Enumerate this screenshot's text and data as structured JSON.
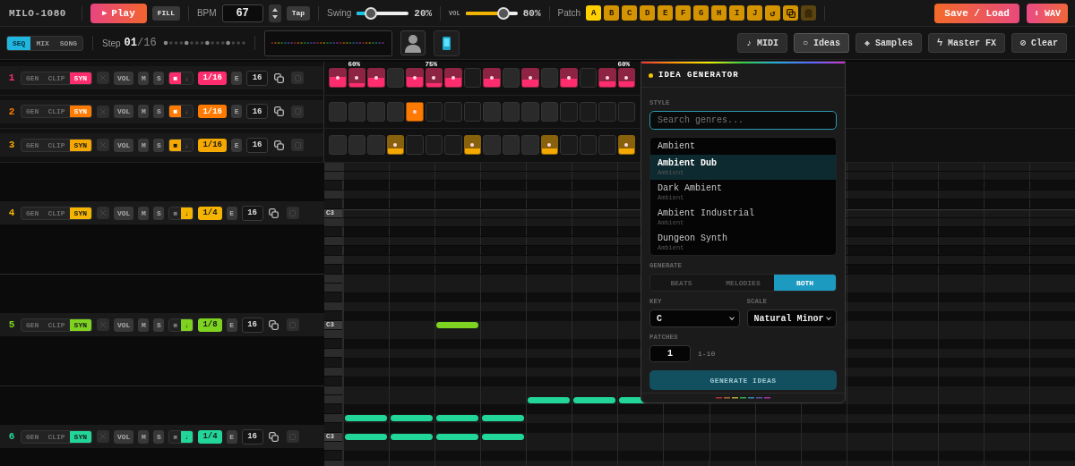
{
  "app": {
    "title": "MILO-1080"
  },
  "transport": {
    "play": {
      "icon": "▶",
      "label": "Play"
    },
    "fill": "FILL",
    "bpm_label": "BPM",
    "bpm": "67",
    "tap": "Tap",
    "swing": {
      "label": "Swing",
      "level": 0.2,
      "reading": "20%"
    },
    "volume": {
      "label": "VOL",
      "level": 0.8,
      "reading": "80%"
    }
  },
  "patches": {
    "label": "Patch",
    "items": [
      {
        "label": "A",
        "selected": true
      },
      {
        "label": "B",
        "selected": false
      },
      {
        "label": "C",
        "selected": false
      },
      {
        "label": "D",
        "selected": false
      },
      {
        "label": "E",
        "selected": false
      },
      {
        "label": "F",
        "selected": false
      },
      {
        "label": "G",
        "selected": false
      },
      {
        "label": "H",
        "selected": false
      },
      {
        "label": "I",
        "selected": false
      },
      {
        "label": "J",
        "selected": false
      }
    ],
    "tools": [
      {
        "kind": "undo",
        "glyph": "↺",
        "disabled": false
      },
      {
        "kind": "copy",
        "disabled": false
      },
      {
        "kind": "paste",
        "disabled": true
      }
    ]
  },
  "file": {
    "save": "Save / Load",
    "export": "⬇ WAV"
  },
  "views": [
    {
      "label": "SEQ",
      "selected": true
    },
    {
      "label": "MIX",
      "selected": false
    },
    {
      "label": "SONG",
      "selected": false
    }
  ],
  "step": {
    "label": "Step",
    "current": "01",
    "total": "/16"
  },
  "tools": [
    {
      "label": "♪ MIDI",
      "selected": false
    },
    {
      "label": "○ Ideas",
      "selected": true
    },
    {
      "label": "◈ Samples",
      "selected": false
    },
    {
      "label": "ϟ Master FX",
      "selected": false
    },
    {
      "label": "⊘ Clear",
      "selected": false
    }
  ],
  "tracks": [
    {
      "number": "1",
      "color": "#ff2d6e",
      "kind": "steps",
      "sources": [
        {
          "label": "GEN",
          "selected": false
        },
        {
          "label": "CLIP",
          "selected": false
        },
        {
          "label": "SYN",
          "selected": true
        }
      ],
      "vol": "VOL",
      "mute": "M",
      "solo": "S",
      "modes": [
        {
          "label": "■",
          "selected": true
        },
        {
          "label": "♩",
          "selected": false
        }
      ],
      "division": "1/16",
      "edit": "E",
      "length": "16",
      "steps": [
        {
          "on": true,
          "level": 0.55
        },
        {
          "on": true,
          "level": 0.2,
          "label": "60%"
        },
        {
          "on": true,
          "level": 0.5
        },
        {
          "on": false
        },
        {
          "on": true,
          "level": 0.55
        },
        {
          "on": true,
          "level": 0.2,
          "label": "75%"
        },
        {
          "on": true,
          "level": 0.5
        },
        {
          "on": false
        },
        {
          "on": true,
          "level": 0.45
        },
        {
          "on": false
        },
        {
          "on": true,
          "level": 0.4
        },
        {
          "on": false
        },
        {
          "on": true,
          "level": 0.45
        },
        {
          "on": false
        },
        {
          "on": true,
          "level": 0.3
        },
        {
          "on": true,
          "level": 0.3,
          "label": "60%"
        }
      ]
    },
    {
      "number": "2",
      "color": "#ff7a00",
      "kind": "steps",
      "sources": [
        {
          "label": "GEN",
          "selected": false
        },
        {
          "label": "CLIP",
          "selected": false
        },
        {
          "label": "SYN",
          "selected": true
        }
      ],
      "vol": "VOL",
      "mute": "M",
      "solo": "S",
      "modes": [
        {
          "label": "■",
          "selected": true
        },
        {
          "label": "♩",
          "selected": false
        }
      ],
      "division": "1/16",
      "edit": "E",
      "length": "16",
      "steps": [
        {
          "on": false
        },
        {
          "on": false
        },
        {
          "on": false
        },
        {
          "on": false
        },
        {
          "on": true,
          "level": 1
        },
        {
          "on": false
        },
        {
          "on": false
        },
        {
          "on": false
        },
        {
          "on": false
        },
        {
          "on": false
        },
        {
          "on": false
        },
        {
          "on": false
        },
        {
          "on": false
        },
        {
          "on": false
        },
        {
          "on": false
        },
        {
          "on": false
        }
      ]
    },
    {
      "number": "3",
      "color": "#f5a800",
      "kind": "steps",
      "sources": [
        {
          "label": "GEN",
          "selected": false
        },
        {
          "label": "CLIP",
          "selected": false
        },
        {
          "label": "SYN",
          "selected": true
        }
      ],
      "vol": "VOL",
      "mute": "M",
      "solo": "S",
      "modes": [
        {
          "label": "■",
          "selected": true
        },
        {
          "label": "♩",
          "selected": false
        }
      ],
      "division": "1/16",
      "edit": "E",
      "length": "16",
      "steps": [
        {
          "on": false
        },
        {
          "on": false
        },
        {
          "on": false
        },
        {
          "on": true,
          "level": 0.3
        },
        {
          "on": false
        },
        {
          "on": false
        },
        {
          "on": false
        },
        {
          "on": true,
          "level": 0.3
        },
        {
          "on": false
        },
        {
          "on": false
        },
        {
          "on": false
        },
        {
          "on": true,
          "level": 0.3
        },
        {
          "on": false
        },
        {
          "on": false
        },
        {
          "on": false
        },
        {
          "on": true,
          "level": 0.3
        }
      ]
    },
    {
      "number": "4",
      "color": "#f5b400",
      "kind": "roll",
      "sources": [
        {
          "label": "GEN",
          "selected": false
        },
        {
          "label": "CLIP",
          "selected": false
        },
        {
          "label": "SYN",
          "selected": true
        }
      ],
      "vol": "VOL",
      "mute": "M",
      "solo": "S",
      "modes": [
        {
          "label": "■",
          "selected": false
        },
        {
          "label": "♩",
          "selected": true
        }
      ],
      "division": "1/4",
      "edit": "E",
      "length": "16",
      "root_label": "C3"
    },
    {
      "number": "5",
      "color": "#7ed321",
      "kind": "roll",
      "sources": [
        {
          "label": "GEN",
          "selected": false
        },
        {
          "label": "CLIP",
          "selected": false
        },
        {
          "label": "SYN",
          "selected": true
        }
      ],
      "vol": "VOL",
      "mute": "M",
      "solo": "S",
      "modes": [
        {
          "label": "■",
          "selected": false
        },
        {
          "label": "♩",
          "selected": true
        }
      ],
      "division": "1/8",
      "edit": "E",
      "length": "16",
      "root_label": "C3",
      "lanes": [
        [
          false,
          false,
          false,
          false,
          false,
          false,
          false,
          false,
          false,
          false,
          false,
          false,
          false,
          false,
          false,
          false
        ],
        [
          false,
          false,
          false,
          false,
          false,
          false,
          false,
          false,
          false,
          false,
          false,
          false,
          false,
          false,
          false,
          false
        ],
        [
          false,
          false,
          false,
          false,
          false,
          false,
          false,
          false,
          false,
          false,
          false,
          false,
          false,
          false,
          false,
          false
        ],
        [
          false,
          false,
          false,
          false,
          false,
          false,
          false,
          false,
          false,
          false,
          false,
          false,
          false,
          false,
          false,
          false
        ],
        [
          false,
          false,
          false,
          false,
          false,
          false,
          false,
          false,
          false,
          false,
          false,
          false,
          false,
          false,
          false,
          false
        ],
        [
          false,
          false,
          true,
          false,
          false,
          false,
          false,
          false,
          false,
          false,
          false,
          false,
          false,
          false,
          false,
          false
        ],
        [
          false,
          false,
          false,
          false,
          false,
          false,
          false,
          false,
          false,
          false,
          false,
          false,
          false,
          false,
          false,
          false
        ],
        [
          false,
          false,
          false,
          false,
          false,
          false,
          false,
          false,
          false,
          false,
          false,
          false,
          false,
          false,
          false,
          false
        ],
        [
          false,
          false,
          false,
          false,
          false,
          false,
          false,
          false,
          false,
          false,
          false,
          false,
          false,
          false,
          false,
          false
        ],
        [
          false,
          false,
          false,
          false,
          false,
          false,
          false,
          false,
          false,
          false,
          false,
          false,
          false,
          false,
          false,
          false
        ],
        [
          false,
          false,
          false,
          false,
          false,
          false,
          false,
          false,
          false,
          false,
          false,
          false,
          false,
          false,
          false,
          false
        ],
        [
          false,
          false,
          false,
          false,
          false,
          false,
          false,
          false,
          false,
          false,
          false,
          false,
          false,
          false,
          false,
          false
        ]
      ]
    },
    {
      "number": "6",
      "color": "#22d69a",
      "kind": "roll",
      "sources": [
        {
          "label": "GEN",
          "selected": false
        },
        {
          "label": "CLIP",
          "selected": false
        },
        {
          "label": "SYN",
          "selected": true
        }
      ],
      "vol": "VOL",
      "mute": "M",
      "solo": "S",
      "modes": [
        {
          "label": "■",
          "selected": false
        },
        {
          "label": "♩",
          "selected": true
        }
      ],
      "division": "1/4",
      "edit": "E",
      "length": "16",
      "root_label": "C3",
      "lanes": [
        [
          false,
          false,
          false,
          false,
          false,
          false,
          false,
          false,
          false,
          false,
          false,
          false,
          false,
          false,
          false,
          false
        ],
        [
          false,
          false,
          false,
          false,
          true,
          true,
          true,
          false,
          false,
          false,
          false,
          false,
          false,
          false,
          false,
          false
        ],
        [
          false,
          false,
          false,
          false,
          false,
          false,
          false,
          false,
          false,
          false,
          false,
          false,
          false,
          false,
          false,
          false
        ],
        [
          true,
          true,
          true,
          true,
          false,
          false,
          false,
          false,
          false,
          false,
          false,
          false,
          false,
          false,
          false,
          false
        ],
        [
          false,
          false,
          false,
          false,
          false,
          false,
          false,
          false,
          false,
          false,
          false,
          false,
          false,
          false,
          false,
          false
        ],
        [
          true,
          true,
          true,
          true,
          false,
          false,
          false,
          false,
          false,
          false,
          false,
          false,
          false,
          false,
          false,
          false
        ],
        [
          false,
          false,
          false,
          false,
          false,
          false,
          false,
          false,
          false,
          false,
          false,
          false,
          false,
          false,
          false,
          false
        ],
        [
          false,
          false,
          false,
          false,
          false,
          false,
          false,
          false,
          false,
          false,
          false,
          false,
          false,
          false,
          false,
          false
        ]
      ]
    }
  ],
  "idea_generator": {
    "title": "IDEA GENERATOR",
    "style_label": "STYLE",
    "search_placeholder": "Search genres...",
    "genres": [
      {
        "name": "Ambient",
        "selected": false
      },
      {
        "name": "Ambient Dub",
        "category": "Ambient",
        "selected": true
      },
      {
        "name": "Dark Ambient",
        "category": "Ambient",
        "selected": false
      },
      {
        "name": "Ambient Industrial",
        "category": "Ambient",
        "selected": false
      },
      {
        "name": "Dungeon Synth",
        "category": "Ambient",
        "selected": false
      }
    ],
    "generate_label": "GENERATE",
    "modes": [
      {
        "label": "BEATS",
        "selected": false
      },
      {
        "label": "MELODIES",
        "selected": false
      },
      {
        "label": "BOTH",
        "selected": true
      }
    ],
    "key_label": "KEY",
    "key": "C",
    "scale_label": "SCALE",
    "scale": "Natural Minor",
    "patches_label": "PATCHES",
    "patches": "1",
    "patches_hint": "1-10",
    "button": {
      "label": "GENERATE IDEAS",
      "disabled": true
    }
  }
}
